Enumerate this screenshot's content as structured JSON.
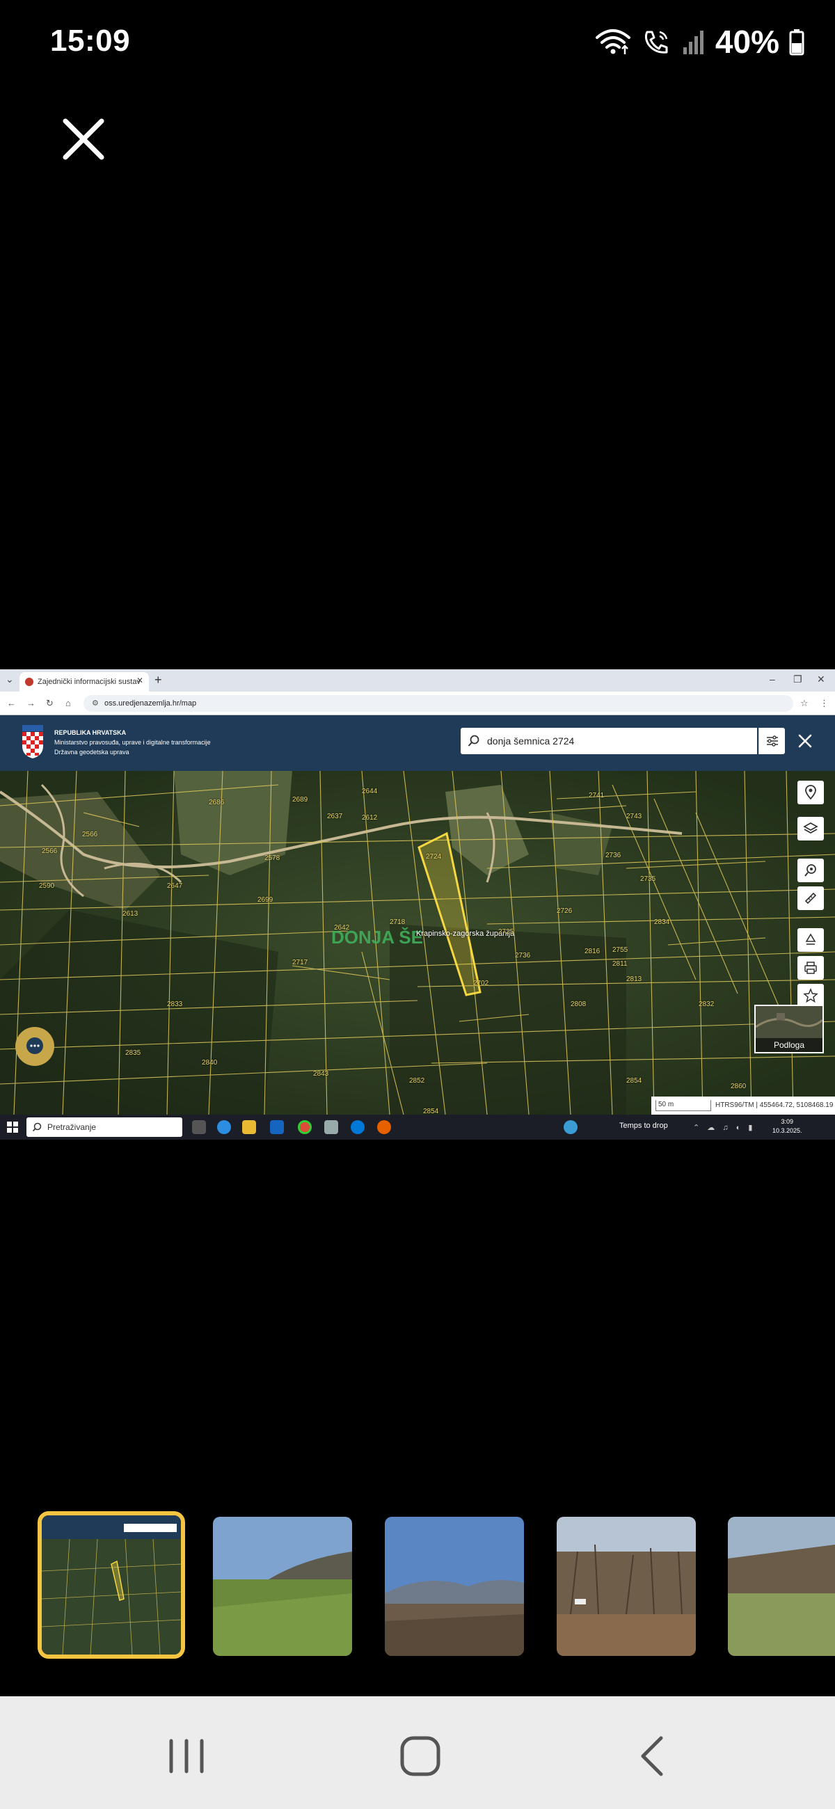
{
  "status": {
    "time": "15:09",
    "battery": "40%"
  },
  "browser": {
    "tab_title": "Zajednički informacijski sustav",
    "url": "oss.uredjenazemlja.hr/map"
  },
  "site": {
    "org_line1": "REPUBLIKA HRVATSKA",
    "org_line2": "Ministarstvo pravosuđa, uprave i digitalne transformacije",
    "org_line3": "Državna geodetska uprava",
    "search_value": "donja šemnica 2724"
  },
  "map": {
    "place_label": "DONJA ŠE",
    "road_label": "Krapinsko-zagorska županija",
    "parcel_numbers": [
      "2686",
      "2689",
      "2612",
      "2578",
      "2613",
      "2647",
      "2724",
      "2725",
      "2726",
      "2718",
      "2741",
      "2743",
      "2736",
      "2735",
      "2755",
      "2808",
      "2835",
      "2840",
      "2852",
      "2854",
      "2860",
      "2832",
      "2816",
      "2811",
      "2813",
      "2834",
      "2843",
      "2833",
      "2644",
      "2637",
      "2642",
      "2566",
      "2566",
      "2590",
      "2699",
      "2717",
      "2702",
      "2736",
      "2854"
    ],
    "base_layer_label": "Podloga",
    "scale_label": "50 m",
    "coord_readout": "HTRS96/TM | 455464.72, 5108468.19"
  },
  "taskbar": {
    "search_placeholder": "Pretraživanje",
    "weather": "Temps to drop",
    "time": "3:09",
    "date": "10.3.2025."
  },
  "colors": {
    "header": "#1f3b58",
    "highlight": "#f5d742",
    "thumb_selected": "#f5c542"
  },
  "icons": [
    "close-icon",
    "wifi-icon",
    "call-icon",
    "signal-icon",
    "battery-icon",
    "search-icon",
    "filter-icon",
    "location-pin-icon",
    "layers-icon",
    "zoom-search-icon",
    "ruler-icon",
    "recycle-icon",
    "print-icon",
    "star-icon",
    "chat-icon",
    "recents-icon",
    "home-icon",
    "back-icon"
  ]
}
